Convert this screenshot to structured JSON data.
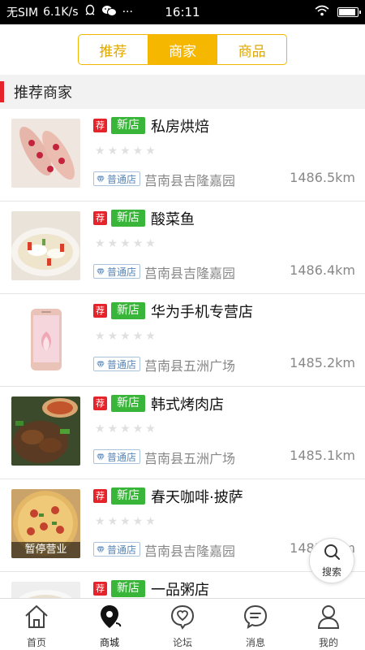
{
  "status_bar": {
    "carrier": "无SIM",
    "speed": "6.1K/s",
    "time": "16:11",
    "battery_level": 0.95
  },
  "tabs": [
    {
      "label": "推荐",
      "active": false
    },
    {
      "label": "商家",
      "active": true
    },
    {
      "label": "商品",
      "active": false
    }
  ],
  "section": {
    "title": "推荐商家"
  },
  "badges": {
    "recommend": "荐",
    "new": "新店",
    "normal": "普通店"
  },
  "stores": [
    {
      "name": "私房烘焙",
      "address": "莒南县吉隆嘉园",
      "distance": "1486.5km",
      "rating": 0,
      "thumb": "pastry-photo",
      "status": ""
    },
    {
      "name": "酸菜鱼",
      "address": "莒南县吉隆嘉园",
      "distance": "1486.4km",
      "rating": 0,
      "thumb": "fish-dish-photo",
      "status": ""
    },
    {
      "name": "华为手机专营店",
      "address": "莒南县五洲广场",
      "distance": "1485.2km",
      "rating": 0,
      "thumb": "phone-photo",
      "status": ""
    },
    {
      "name": "韩式烤肉店",
      "address": "莒南县五洲广场",
      "distance": "1485.1km",
      "rating": 0,
      "thumb": "bbq-photo",
      "status": ""
    },
    {
      "name": "春天咖啡·披萨",
      "address": "莒南县吉隆嘉园",
      "distance": "1485.1km",
      "rating": 0,
      "thumb": "pizza-photo",
      "status": "暂停营业"
    },
    {
      "name": "一品粥店",
      "address": "",
      "distance": "",
      "rating": 0,
      "thumb": "porridge-photo",
      "status": ""
    }
  ],
  "float_search": {
    "label": "搜索"
  },
  "nav": [
    {
      "label": "首页",
      "icon": "home-icon",
      "active": false
    },
    {
      "label": "商城",
      "icon": "map-pin-icon",
      "active": true
    },
    {
      "label": "论坛",
      "icon": "heart-chat-icon",
      "active": false
    },
    {
      "label": "消息",
      "icon": "message-icon",
      "active": false
    },
    {
      "label": "我的",
      "icon": "user-icon",
      "active": false
    }
  ],
  "colors": {
    "accent": "#f5b700",
    "red": "#e6232a",
    "green": "#39b539"
  }
}
